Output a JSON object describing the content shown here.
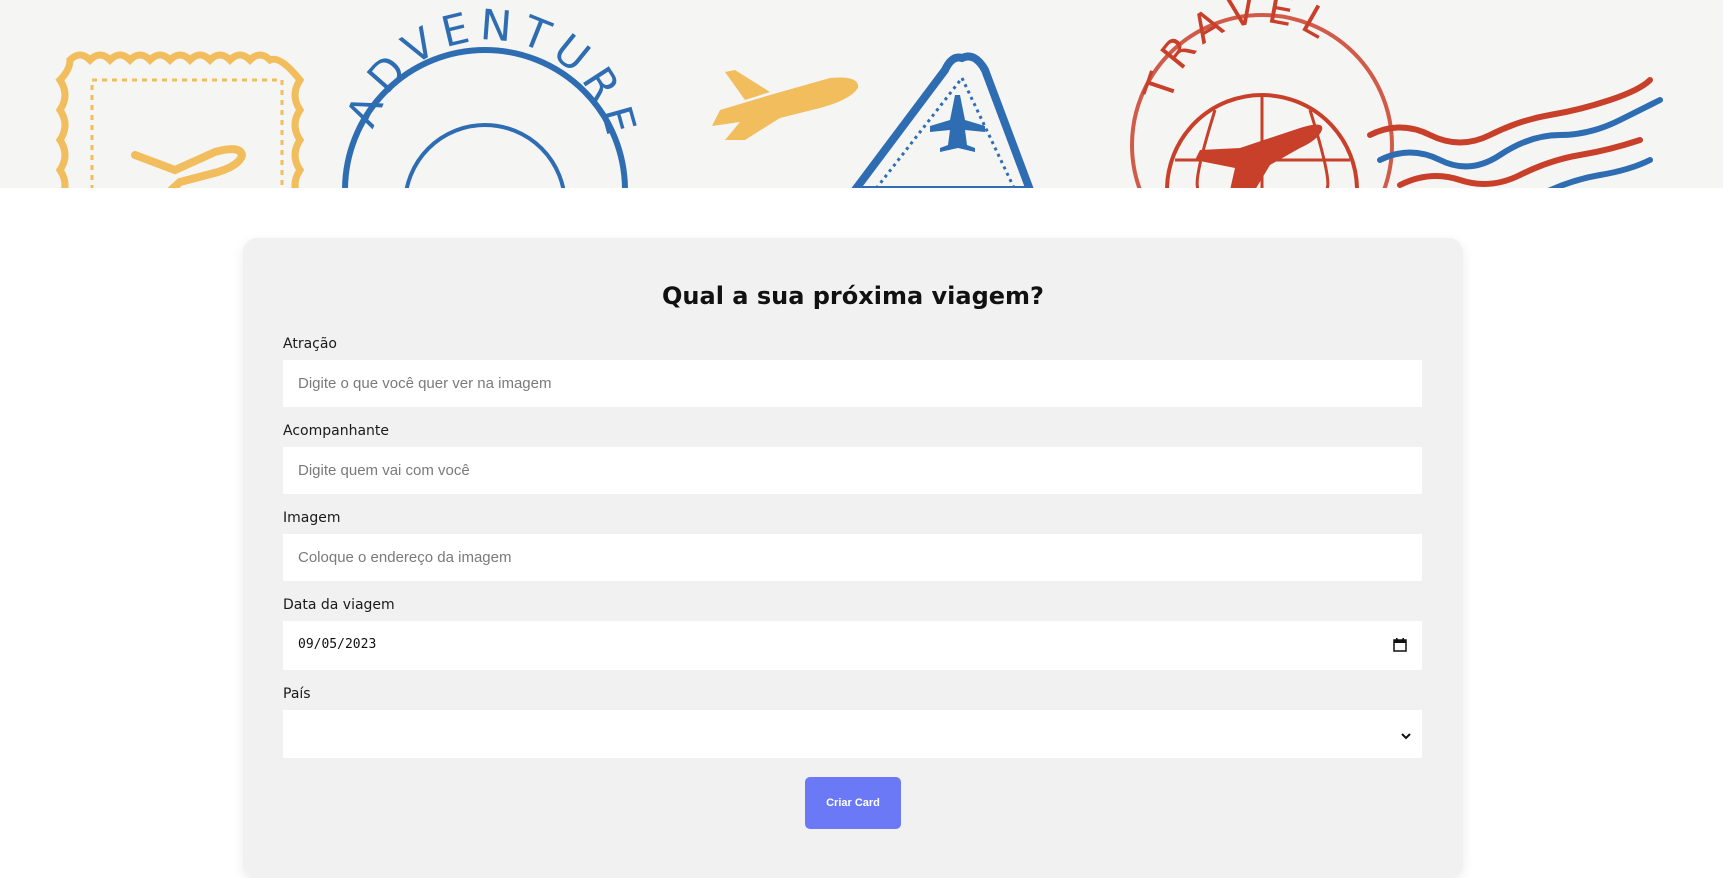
{
  "banner": {
    "stamp_adventure_text": "ADVENTURE",
    "stamp_travel_text": "TRAVEL",
    "colors": {
      "yellow": "#f2bd5c",
      "blue": "#2f6db3",
      "red": "#c9402a"
    }
  },
  "form": {
    "title": "Qual a sua próxima viagem?",
    "fields": {
      "atracao": {
        "label": "Atração",
        "placeholder": "Digite o que você quer ver na imagem"
      },
      "acompanhante": {
        "label": "Acompanhante",
        "placeholder": "Digite quem vai com você"
      },
      "imagem": {
        "label": "Imagem",
        "placeholder": "Coloque o endereço da imagem"
      },
      "data": {
        "label": "Data da viagem",
        "value": "09/05/2023"
      },
      "pais": {
        "label": "País",
        "value": ""
      }
    },
    "submit_label": "Criar Card",
    "accent_color": "#6b79f6"
  }
}
